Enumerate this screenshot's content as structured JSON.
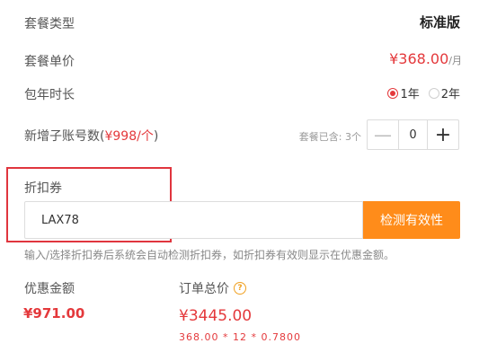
{
  "package_type": {
    "label": "套餐类型",
    "value": "标准版"
  },
  "package_price": {
    "label": "套餐单价",
    "amount": "¥368.00",
    "unit": "/月"
  },
  "annual_duration": {
    "label": "包年时长",
    "options": [
      {
        "label": "1年",
        "selected": true
      },
      {
        "label": "2年",
        "selected": false
      }
    ]
  },
  "sub_accounts": {
    "label_prefix": "新增子账号数(",
    "label_price": "¥998/个",
    "label_suffix": ")",
    "included_text": "套餐已含: 3个",
    "minus": "—",
    "value": "0",
    "plus": "+"
  },
  "coupon": {
    "label": "折扣券",
    "input_value": "LAX78",
    "check_button": "检测有效性",
    "hint": "输入/选择折扣券后系统会自动检测折扣券，如折扣券有效则显示在优惠金额。"
  },
  "discount": {
    "label": "优惠金额",
    "value": "¥971.00"
  },
  "order_total": {
    "label": "订单总价",
    "help_icon": "?",
    "value": "¥3445.00",
    "formula": "368.00 * 12 * 0.7800"
  },
  "colors": {
    "accent_red": "#e4393c",
    "button_orange": "#ff8c1a",
    "highlight_border": "#e0353e"
  }
}
